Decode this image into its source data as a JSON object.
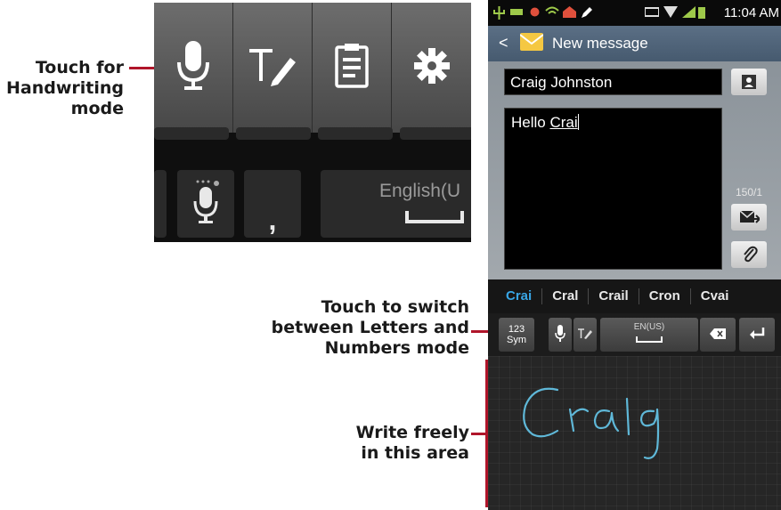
{
  "callouts": {
    "handwriting": [
      "Touch for",
      "Handwriting",
      "mode"
    ],
    "switch": [
      "Touch to switch",
      "between Letters and",
      "Numbers mode"
    ],
    "write": [
      "Write freely",
      "in this area"
    ]
  },
  "zoom": {
    "toolbar_icons": [
      "microphone-icon",
      "handwriting-icon",
      "clipboard-icon",
      "settings-icon"
    ],
    "space_label": "English(U"
  },
  "phone": {
    "status_time": "11:04 AM",
    "app_title": "New message",
    "recipient": "Craig Johnston",
    "message_prefix": "Hello ",
    "message_word": "Crai",
    "char_counter": "150/1",
    "suggestions": [
      "Crai",
      "Cral",
      "Crail",
      "Cron",
      "Cvai"
    ],
    "keys": {
      "sym_top": "123",
      "sym_bottom": "Sym",
      "space_label": "EN(US)"
    },
    "handwriting_text": "Craig"
  },
  "colors": {
    "leader": "#b0152a",
    "suggestion_active": "#38a6e6",
    "ink": "#5fb8d8"
  }
}
